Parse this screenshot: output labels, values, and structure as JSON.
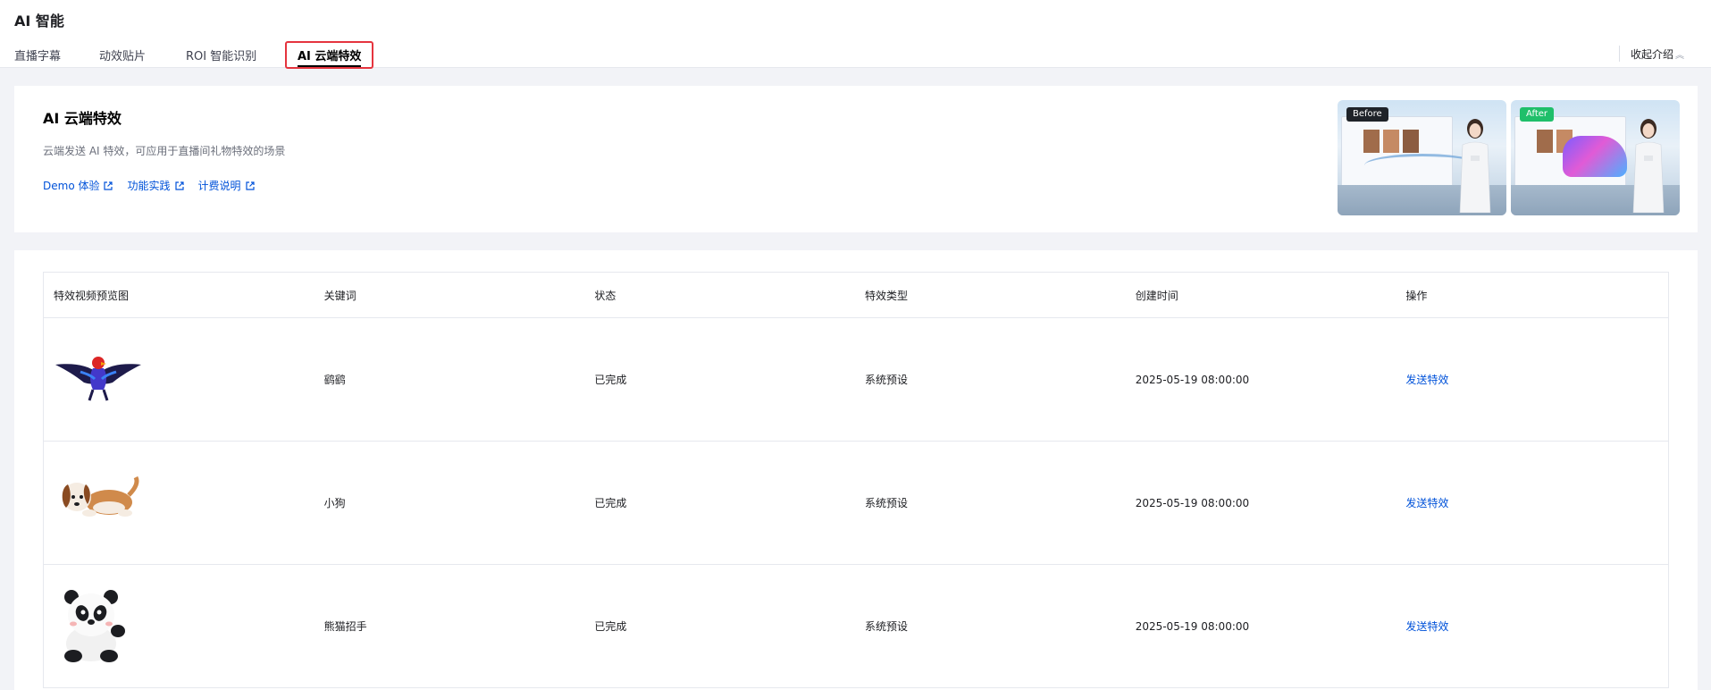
{
  "app": {
    "title": "AI 智能"
  },
  "tabs": [
    {
      "label": "直播字幕"
    },
    {
      "label": "动效贴片"
    },
    {
      "label": "ROI 智能识别"
    },
    {
      "label": "AI 云端特效",
      "active": true
    }
  ],
  "collapse": {
    "label": "收起介绍"
  },
  "intro": {
    "title": "AI 云端特效",
    "description": "云端发送 AI 特效，可应用于直播间礼物特效的场景",
    "links": [
      {
        "label": "Demo 体验"
      },
      {
        "label": "功能实践"
      },
      {
        "label": "计费说明"
      }
    ],
    "previews": [
      {
        "badge": "Before"
      },
      {
        "badge": "After"
      }
    ]
  },
  "table": {
    "columns": [
      "特效视频预览图",
      "关键词",
      "状态",
      "特效类型",
      "创建时间",
      "操作"
    ],
    "rows": [
      {
        "icon": "eagle-icon",
        "keyword": "鹞鹞",
        "status": "已完成",
        "type": "系统预设",
        "created": "2025-05-19 08:00:00",
        "action": "发送特效"
      },
      {
        "icon": "puppy-icon",
        "keyword": "小狗",
        "status": "已完成",
        "type": "系统预设",
        "created": "2025-05-19 08:00:00",
        "action": "发送特效"
      },
      {
        "icon": "panda-icon",
        "keyword": "熊猫招手",
        "status": "已完成",
        "type": "系统预设",
        "created": "2025-05-19 08:00:00",
        "action": "发送特效"
      }
    ]
  },
  "colors": {
    "accent": "#0052d9",
    "highlight": "#e5343e",
    "badge_after": "#1fbf6a"
  }
}
